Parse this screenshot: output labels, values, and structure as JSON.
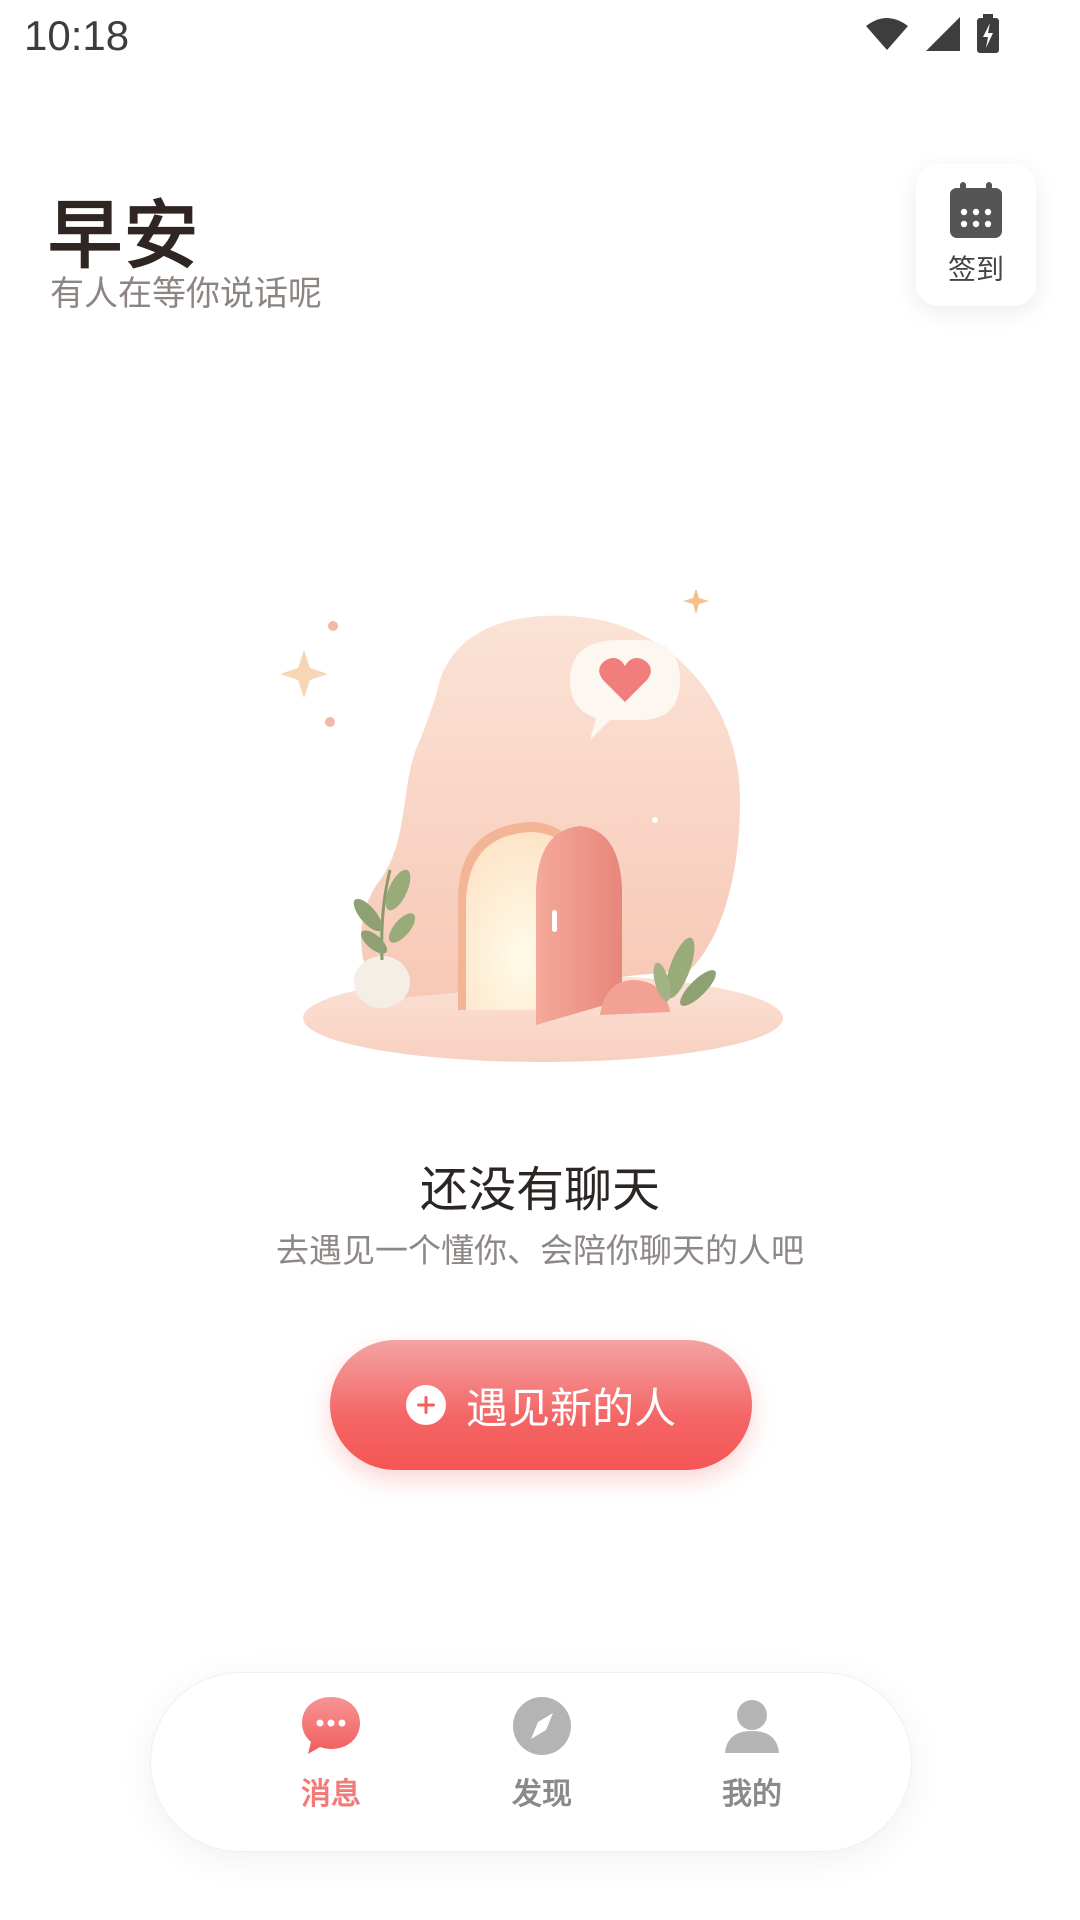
{
  "status_bar": {
    "time": "10:18"
  },
  "header": {
    "greeting": "早安",
    "subtitle": "有人在等你说话呢",
    "checkin_label": "签到"
  },
  "empty_state": {
    "title": "还没有聊天",
    "description": "去遇见一个懂你、会陪你聊天的人吧",
    "button_label": "遇见新的人"
  },
  "bottom_nav": {
    "items": [
      {
        "label": "消息",
        "icon": "chat-bubble-icon",
        "active": true
      },
      {
        "label": "发现",
        "icon": "compass-icon",
        "active": false
      },
      {
        "label": "我的",
        "icon": "person-icon",
        "active": false
      }
    ]
  },
  "colors": {
    "accent": "#f55a5a",
    "active_tab": "#f47a7a",
    "inactive_tab": "#8a8a8a"
  }
}
